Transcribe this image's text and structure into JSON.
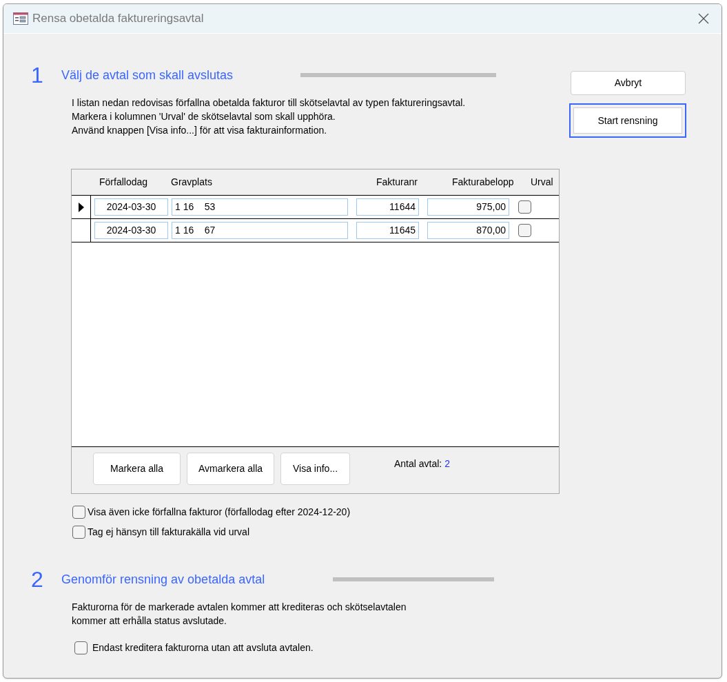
{
  "window": {
    "title": "Rensa obetalda faktureringsavtal"
  },
  "section_1": {
    "number": "1",
    "title": "Välj de avtal som skall avslutas",
    "description": [
      "I listan nedan redovisas förfallna obetalda fakturor till skötselavtal av typen faktureringsavtal.",
      "Markera i kolumnen 'Urval' de skötselavtal som skall upphöra.",
      "Använd knappen [Visa info...] för att visa fakturainformation."
    ]
  },
  "side_buttons": [
    {
      "label": "Avbryt",
      "focused": false
    },
    {
      "label": "Start rensning",
      "focused": true
    }
  ],
  "table": {
    "columns": [
      "Förfallodag",
      "Gravplats",
      "Fakturanr",
      "Fakturabelopp",
      "Urval"
    ],
    "rows": [
      {
        "selected": true,
        "forfallodag": "2024-03-30",
        "gravplats": "1 16    53",
        "fakturanr": "11644",
        "fakturabelopp": "975,00",
        "urval": false
      },
      {
        "selected": false,
        "forfallodag": "2024-03-30",
        "gravplats": "1 16    67",
        "fakturanr": "11645",
        "fakturabelopp": "870,00",
        "urval": false
      }
    ],
    "footer_buttons": [
      "Markera alla",
      "Avmarkera alla",
      "Visa info..."
    ],
    "count_label": "Antal avtal:",
    "count": "2"
  },
  "options": [
    {
      "label": "Visa även icke förfallna fakturor (förfallodag efter 2024-12-20)",
      "checked": false
    },
    {
      "label": "Tag ej hänsyn till fakturakälla vid urval",
      "checked": false
    }
  ],
  "section_2": {
    "number": "2",
    "title": "Genomför rensning av obetalda avtal",
    "description": [
      "Fakturorna för de markerade avtalen kommer att krediteras och skötselavtalen",
      "kommer att erhålla status avslutade."
    ],
    "option": {
      "label": "Endast kreditera fakturorna utan att avsluta avtalen.",
      "checked": false
    }
  }
}
